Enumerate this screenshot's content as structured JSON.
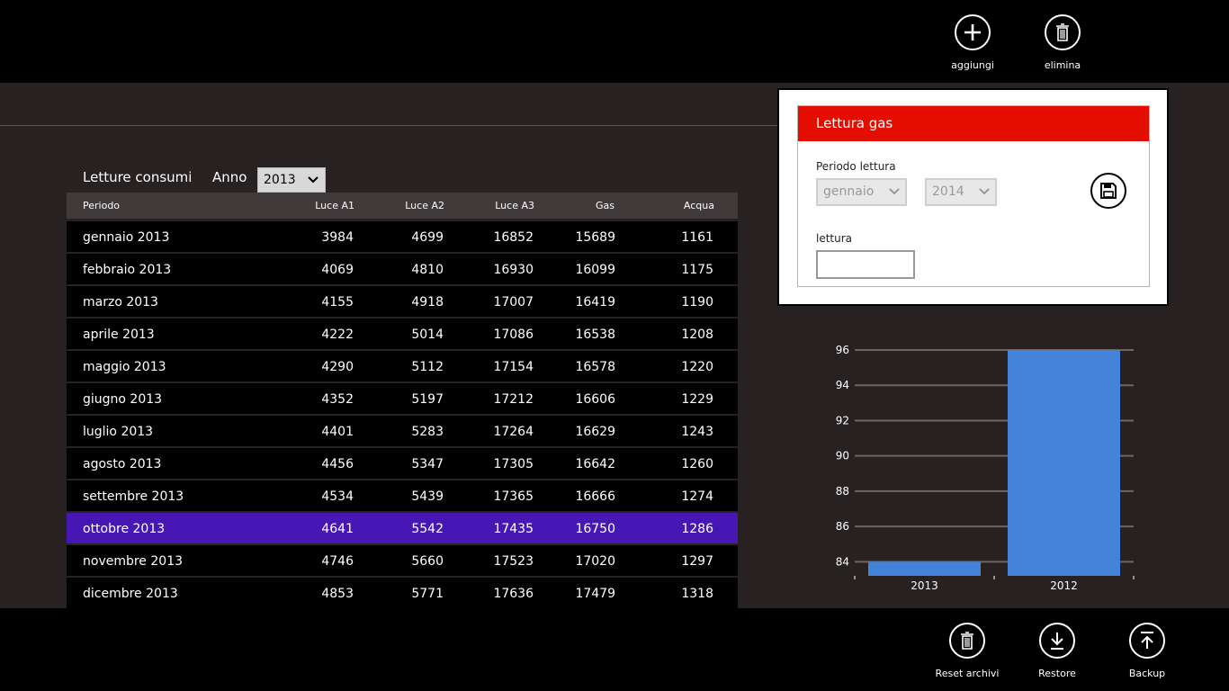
{
  "appbar_top": {
    "add_label": "aggiungi",
    "delete_label": "elimina"
  },
  "appbar_bottom": {
    "reset_label": "Reset archivi",
    "restore_label": "Restore",
    "backup_label": "Backup"
  },
  "main": {
    "title": "Letture consumi",
    "year_label": "Anno",
    "year_value": "2013"
  },
  "table": {
    "headers": [
      "Periodo",
      "Luce A1",
      "Luce A2",
      "Luce A3",
      "Gas",
      "Acqua"
    ],
    "selected_index": 9,
    "rows": [
      [
        "gennaio 2013",
        "3984",
        "4699",
        "16852",
        "15689",
        "1161"
      ],
      [
        "febbraio 2013",
        "4069",
        "4810",
        "16930",
        "16099",
        "1175"
      ],
      [
        "marzo 2013",
        "4155",
        "4918",
        "17007",
        "16419",
        "1190"
      ],
      [
        "aprile 2013",
        "4222",
        "5014",
        "17086",
        "16538",
        "1208"
      ],
      [
        "maggio 2013",
        "4290",
        "5112",
        "17154",
        "16578",
        "1220"
      ],
      [
        "giugno 2013",
        "4352",
        "5197",
        "17212",
        "16606",
        "1229"
      ],
      [
        "luglio 2013",
        "4401",
        "5283",
        "17264",
        "16629",
        "1243"
      ],
      [
        "agosto 2013",
        "4456",
        "5347",
        "17305",
        "16642",
        "1260"
      ],
      [
        "settembre 2013",
        "4534",
        "5439",
        "17365",
        "16666",
        "1274"
      ],
      [
        "ottobre 2013",
        "4641",
        "5542",
        "17435",
        "16750",
        "1286"
      ],
      [
        "novembre 2013",
        "4746",
        "5660",
        "17523",
        "17020",
        "1297"
      ],
      [
        "dicembre 2013",
        "4853",
        "5771",
        "17636",
        "17479",
        "1318"
      ]
    ]
  },
  "panel": {
    "title": "Lettura gas",
    "period_label": "Periodo lettura",
    "month_value": "gennaio",
    "year_value": "2014",
    "reading_label": "lettura",
    "reading_value": ""
  },
  "colors": {
    "header_red": "#e30d00",
    "selected_row": "#4617b4",
    "bar_blue": "#4282d8"
  },
  "chart_data": {
    "type": "bar",
    "categories": [
      "2013",
      "2012"
    ],
    "values": [
      84,
      96
    ],
    "ylim": [
      83.2,
      96
    ],
    "yticks": [
      84,
      86,
      88,
      90,
      92,
      94,
      96
    ],
    "grid": true
  }
}
